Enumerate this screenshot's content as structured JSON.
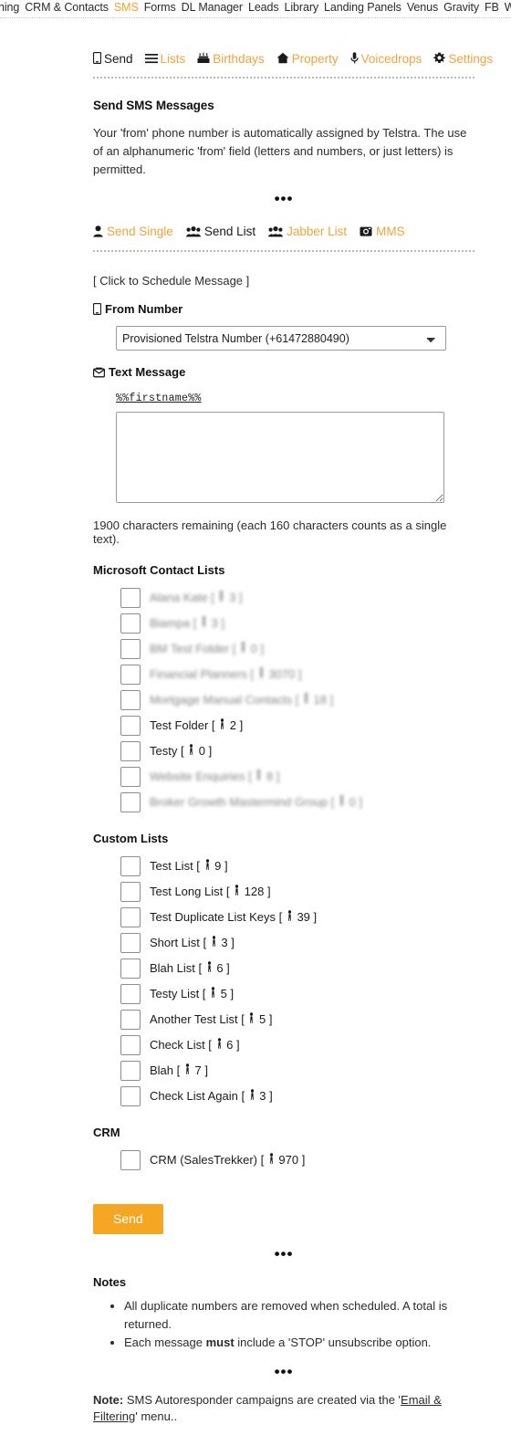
{
  "topnav": {
    "items": [
      {
        "label": "ning",
        "active": false
      },
      {
        "label": "CRM & Contacts",
        "active": false
      },
      {
        "label": "SMS",
        "active": true
      },
      {
        "label": "Forms",
        "active": false
      },
      {
        "label": "DL Manager",
        "active": false
      },
      {
        "label": "Leads",
        "active": false
      },
      {
        "label": "Library",
        "active": false
      },
      {
        "label": "Landing Panels",
        "active": false
      },
      {
        "label": "Venus",
        "active": false
      },
      {
        "label": "Gravity",
        "active": false
      },
      {
        "label": "FB",
        "active": false
      },
      {
        "label": "WP",
        "active": false
      }
    ]
  },
  "subnav": {
    "items": [
      {
        "label": "Send",
        "icon": "mobile-icon",
        "glyph": "⎕",
        "current": true
      },
      {
        "label": "Lists",
        "icon": "bars-icon",
        "glyph": "☰",
        "current": false
      },
      {
        "label": "Birthdays",
        "icon": "cake-icon",
        "glyph": "⤴",
        "current": false
      },
      {
        "label": "Property",
        "icon": "home-icon",
        "glyph": "⌂",
        "current": false
      },
      {
        "label": "Voicedrops",
        "icon": "microphone-icon",
        "glyph": "Ἲ4",
        "current": false
      },
      {
        "label": "Settings",
        "icon": "gear-icon",
        "glyph": "⚙",
        "current": false
      }
    ]
  },
  "header": {
    "title": "Send SMS Messages",
    "description": "Your 'from' phone number is automatically assigned by Telstra. The use of an alphanumeric 'from' field (letters and numbers, or just letters) is permitted.",
    "divider": "•••"
  },
  "modenav": {
    "items": [
      {
        "label": "Send Single",
        "icon": "user-icon",
        "current": false
      },
      {
        "label": "Send List",
        "icon": "users-icon",
        "current": true
      },
      {
        "label": "Jabber List",
        "icon": "users-icon",
        "current": false
      },
      {
        "label": "MMS",
        "icon": "camera-icon",
        "current": false
      }
    ]
  },
  "form": {
    "schedule_link": "[ Click to Schedule Message ]",
    "from_number_label": "From Number",
    "from_number_icon": "mobile-icon",
    "from_number_value": "Provisioned Telstra Number (+61472880490)",
    "from_number_options": [
      "Provisioned Telstra Number (+61472880490)"
    ],
    "text_message_label": "Text Message",
    "text_message_icon": "envelope-icon",
    "merge_token": "%%firstname%%",
    "message_value": "",
    "message_placeholder": "",
    "counter": "1900 characters remaining (each 160 characters counts as a single text)."
  },
  "groups": [
    {
      "heading": "Microsoft Contact Lists",
      "items": [
        {
          "name": "Alana Kate",
          "count": "3",
          "checked": false,
          "redacted": true
        },
        {
          "name": "Biampa",
          "count": "3",
          "checked": false,
          "redacted": true
        },
        {
          "name": "BM Test Folder",
          "count": "0",
          "checked": false,
          "redacted": true
        },
        {
          "name": "Financial Planners",
          "count": "3070",
          "checked": false,
          "redacted": true
        },
        {
          "name": "Mortgage Manual Contacts",
          "count": "18",
          "checked": false,
          "redacted": true
        },
        {
          "name": "Test Folder",
          "count": "2",
          "checked": false,
          "redacted": false
        },
        {
          "name": "Testy",
          "count": "0",
          "checked": false,
          "redacted": false
        },
        {
          "name": "Website Enquiries",
          "count": "8",
          "checked": false,
          "redacted": true
        },
        {
          "name": "Broker Growth Mastermind Group",
          "count": "0",
          "checked": false,
          "redacted": true
        }
      ]
    },
    {
      "heading": "Custom Lists",
      "items": [
        {
          "name": "Test List",
          "count": "9",
          "checked": false,
          "redacted": false
        },
        {
          "name": "Test Long List",
          "count": "128",
          "checked": false,
          "redacted": false
        },
        {
          "name": "Test Duplicate List Keys",
          "count": "39",
          "checked": false,
          "redacted": false
        },
        {
          "name": "Short List",
          "count": "3",
          "checked": false,
          "redacted": false
        },
        {
          "name": "Blah List",
          "count": "6",
          "checked": false,
          "redacted": false
        },
        {
          "name": "Testy List",
          "count": "5",
          "checked": false,
          "redacted": false
        },
        {
          "name": "Another Test List",
          "count": "5",
          "checked": false,
          "redacted": false
        },
        {
          "name": "Check List",
          "count": "6",
          "checked": false,
          "redacted": false
        },
        {
          "name": "Blah",
          "count": "7",
          "checked": false,
          "redacted": false
        },
        {
          "name": "Check List Again",
          "count": "3",
          "checked": false,
          "redacted": false
        }
      ]
    },
    {
      "heading": "CRM",
      "items": [
        {
          "name": "CRM (SalesTrekker)",
          "count": "970",
          "checked": false,
          "redacted": false
        }
      ]
    }
  ],
  "actions": {
    "send_label": "Send"
  },
  "notes": {
    "heading": "Notes",
    "items": [
      {
        "pre": "All duplicate numbers are removed when scheduled. A total is returned.",
        "bold": "",
        "post": ""
      },
      {
        "pre": "Each message ",
        "bold": "must",
        "post": " include a 'STOP' unsubscribe option."
      }
    ]
  },
  "footnote": {
    "label": "Note:",
    "pre": " SMS Autoresponder campaigns are created via the '",
    "link": "Email & Filtering",
    "post": "' menu.."
  },
  "colors": {
    "accent": "#f2a33c",
    "button": "#f5a623",
    "text": "#1a1a1a"
  }
}
